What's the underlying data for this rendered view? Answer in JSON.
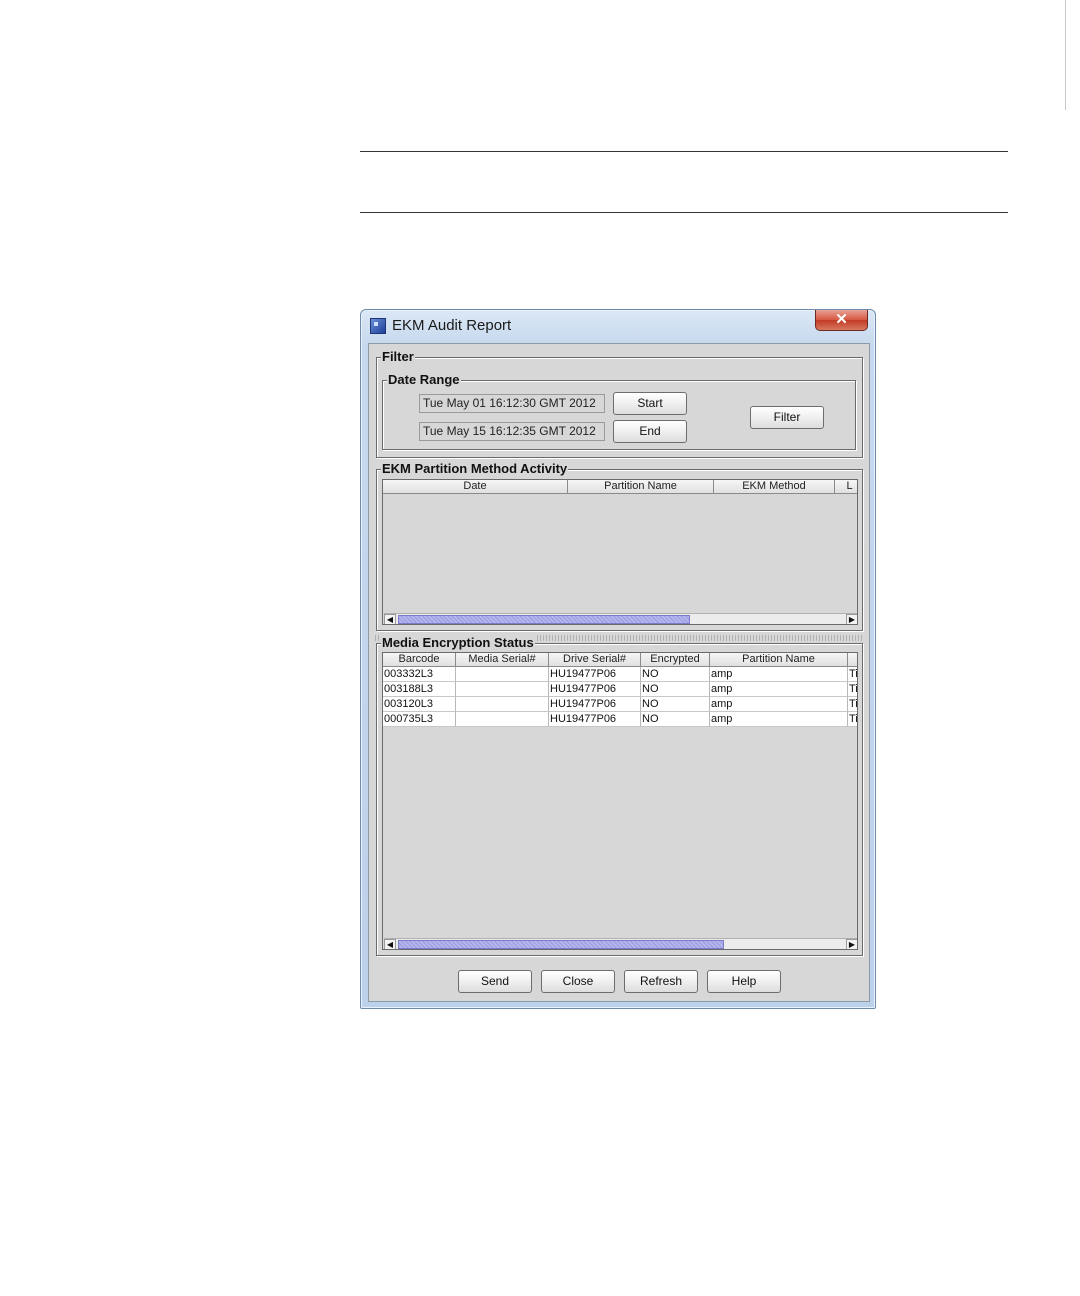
{
  "window": {
    "title": "EKM Audit Report",
    "close_glyph": "✕"
  },
  "filter": {
    "legend": "Filter",
    "date_range": {
      "legend": "Date Range",
      "start_value": "Tue May 01 16:12:30 GMT 2012",
      "end_value": "Tue May 15 16:12:35 GMT 2012",
      "start_label": "Start",
      "end_label": "End"
    },
    "filter_label": "Filter"
  },
  "partition_activity": {
    "legend": "EKM Partition Method Activity",
    "columns": [
      "Date",
      "Partition Name",
      "EKM Method",
      "L"
    ],
    "rows": []
  },
  "media_status": {
    "legend": "Media Encryption Status",
    "columns": [
      "Barcode",
      "Media Serial#",
      "Drive Serial#",
      "Encrypted",
      "Partition Name",
      ""
    ],
    "rows": [
      [
        "003332L3",
        "",
        "HU19477P06",
        "NO",
        "amp",
        "Ti"
      ],
      [
        "003188L3",
        "",
        "HU19477P06",
        "NO",
        "amp",
        "Ti"
      ],
      [
        "003120L3",
        "",
        "HU19477P06",
        "NO",
        "amp",
        "Ti"
      ],
      [
        "000735L3",
        "",
        "HU19477P06",
        "NO",
        "amp",
        "Ti"
      ]
    ]
  },
  "footer": {
    "send": "Send",
    "close": "Close",
    "refresh": "Refresh",
    "help": "Help"
  },
  "scroll_arrows": {
    "left": "◀",
    "right": "▶"
  }
}
